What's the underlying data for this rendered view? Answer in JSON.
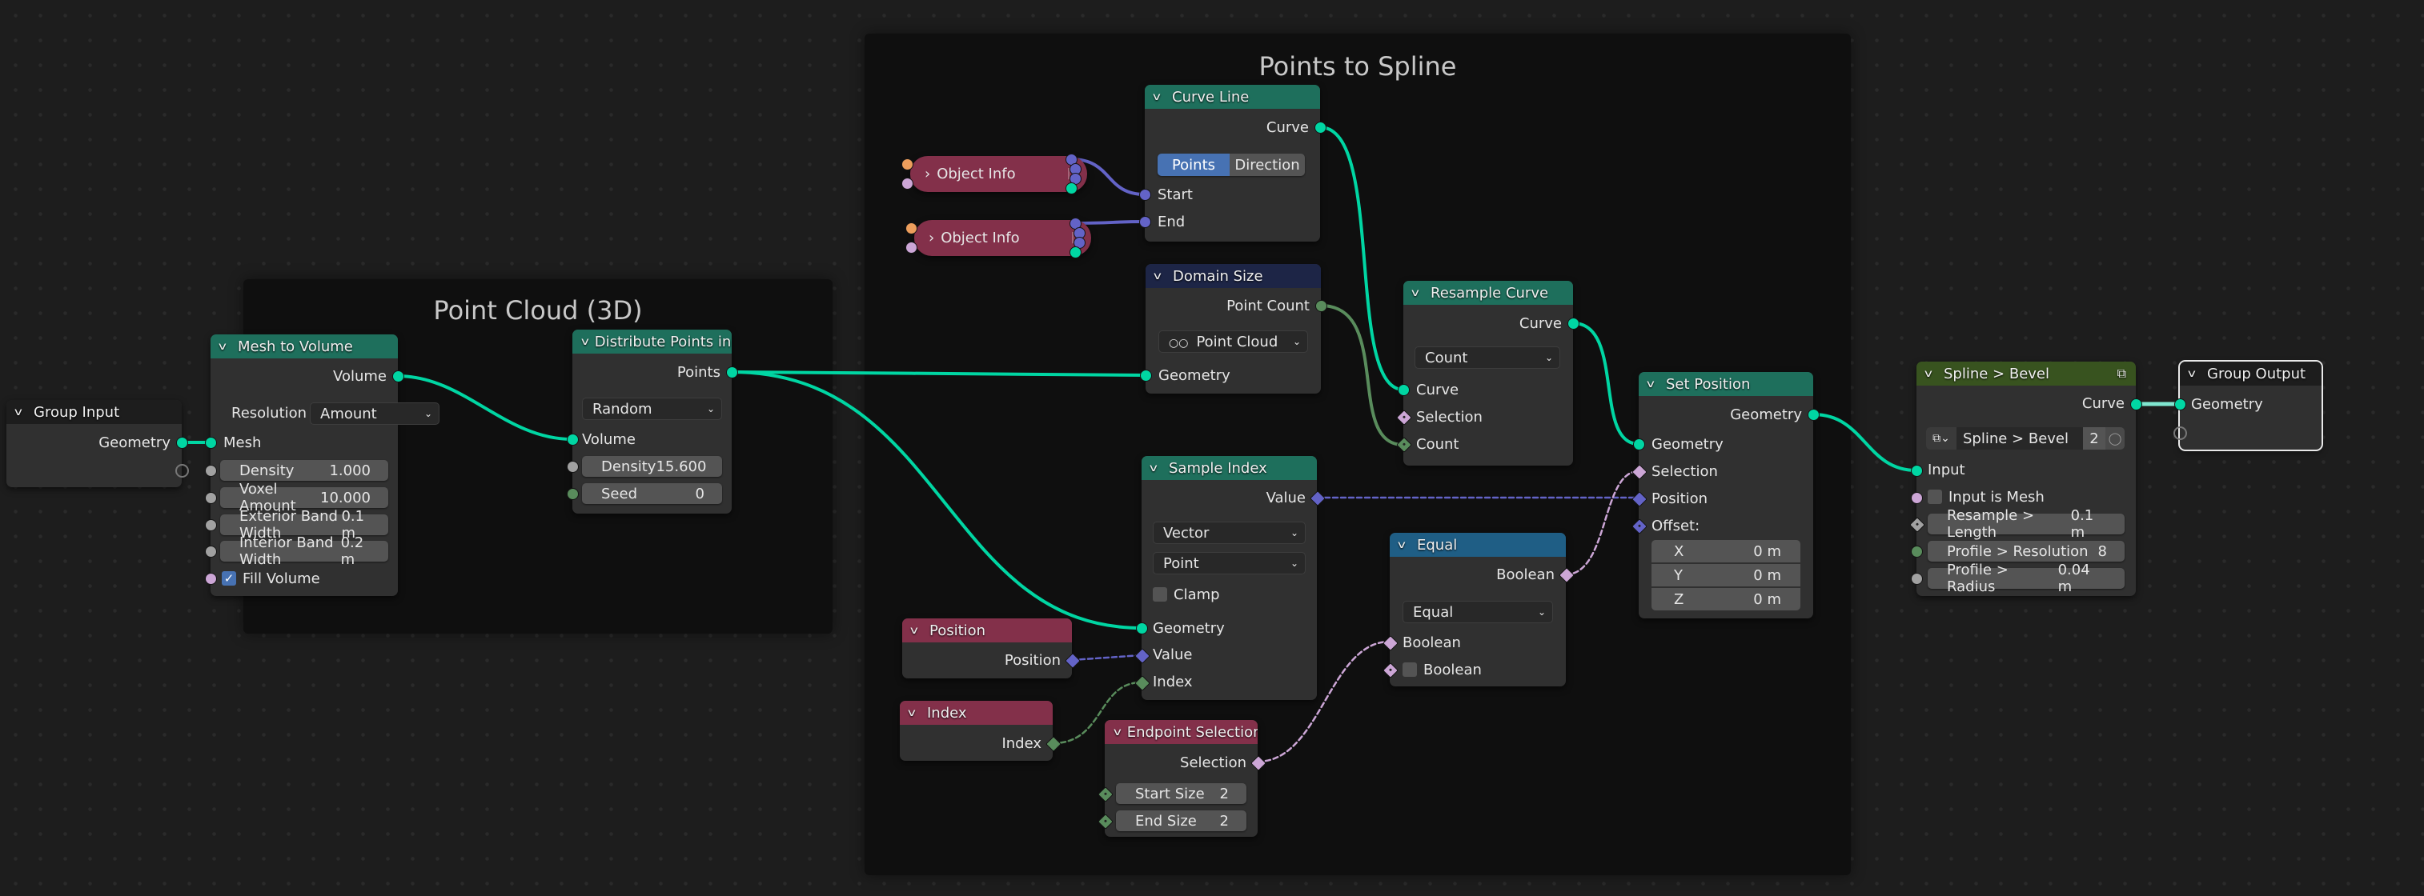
{
  "editor": "Geometry Node Editor",
  "frames": {
    "point_cloud": {
      "title": "Point Cloud (3D)"
    },
    "points_to_spline": {
      "title": "Points to Spline"
    }
  },
  "nodes": {
    "group_input": {
      "title": "Group Input",
      "outputs": [
        "Geometry"
      ]
    },
    "mesh_to_volume": {
      "title": "Mesh to Volume",
      "output": "Volume",
      "resolution_label": "Resolution",
      "resolution_value": "Amount",
      "input_mesh": "Mesh",
      "fields": [
        {
          "label": "Density",
          "value": "1.000"
        },
        {
          "label": "Voxel Amount",
          "value": "10.000"
        },
        {
          "label": "Exterior Band Width",
          "value": "0.1 m"
        },
        {
          "label": "Interior Band Width",
          "value": "0.2 m"
        }
      ],
      "fill_volume": {
        "label": "Fill Volume",
        "checked": true
      }
    },
    "distribute_points": {
      "title": "Distribute Points in Volume",
      "output": "Points",
      "mode": "Random",
      "input_volume": "Volume",
      "fields": [
        {
          "label": "Density",
          "value": "15.600"
        },
        {
          "label": "Seed",
          "value": "0"
        }
      ]
    },
    "object_info_1": {
      "title": "Object Info"
    },
    "object_info_2": {
      "title": "Object Info"
    },
    "curve_line": {
      "title": "Curve Line",
      "output": "Curve",
      "mode_options": [
        "Points",
        "Direction"
      ],
      "mode_selected": "Points",
      "inputs": [
        "Start",
        "End"
      ]
    },
    "domain_size": {
      "title": "Domain Size",
      "output": "Point Count",
      "component": "Point Cloud",
      "input": "Geometry"
    },
    "resample_curve": {
      "title": "Resample Curve",
      "output": "Curve",
      "mode": "Count",
      "inputs": [
        "Curve",
        "Selection",
        "Count"
      ]
    },
    "sample_index": {
      "title": "Sample Index",
      "output": "Value",
      "data_type": "Vector",
      "domain": "Point",
      "clamp": {
        "label": "Clamp",
        "checked": false
      },
      "inputs": [
        "Geometry",
        "Value",
        "Index"
      ]
    },
    "position": {
      "title": "Position",
      "output": "Position"
    },
    "index": {
      "title": "Index",
      "output": "Index"
    },
    "endpoint_selection": {
      "title": "Endpoint Selection",
      "output": "Selection",
      "fields": [
        {
          "label": "Start Size",
          "value": "2"
        },
        {
          "label": "End Size",
          "value": "2"
        }
      ]
    },
    "equal": {
      "title": "Equal",
      "output": "Boolean",
      "operation": "Equal",
      "inputs": [
        "Boolean",
        "Boolean"
      ],
      "b_checked": false
    },
    "set_position": {
      "title": "Set Position",
      "output": "Geometry",
      "inputs": [
        "Geometry",
        "Selection",
        "Position"
      ],
      "offset_label": "Offset:",
      "offset": [
        {
          "axis": "X",
          "value": "0 m"
        },
        {
          "axis": "Y",
          "value": "0 m"
        },
        {
          "axis": "Z",
          "value": "0 m"
        }
      ]
    },
    "spline_bevel": {
      "title": "Spline > Bevel",
      "output": "Curve",
      "group_name": "Spline > Bevel",
      "users": "2",
      "input": "Input",
      "input_is_mesh": {
        "label": "Input is Mesh",
        "checked": false
      },
      "fields": [
        {
          "label": "Resample > Length",
          "value": "0.1 m"
        },
        {
          "label": "Profile > Resolution",
          "value": "8"
        },
        {
          "label": "Profile > Radius",
          "value": "0.04 m"
        }
      ]
    },
    "group_output": {
      "title": "Group Output",
      "inputs": [
        "Geometry"
      ]
    }
  },
  "colors": {
    "geometry_socket": "#00d6a3",
    "float_socket": "#a1a1a1",
    "int_socket": "#598c5c",
    "bool_socket": "#cca6d6",
    "vector_socket": "#6363c7",
    "object_socket": "#ed9e5c",
    "geometry_header": "#1e6f5c",
    "input_header": "#83304a",
    "utility_header": "#1f5e85",
    "group_header": "#38531f"
  }
}
